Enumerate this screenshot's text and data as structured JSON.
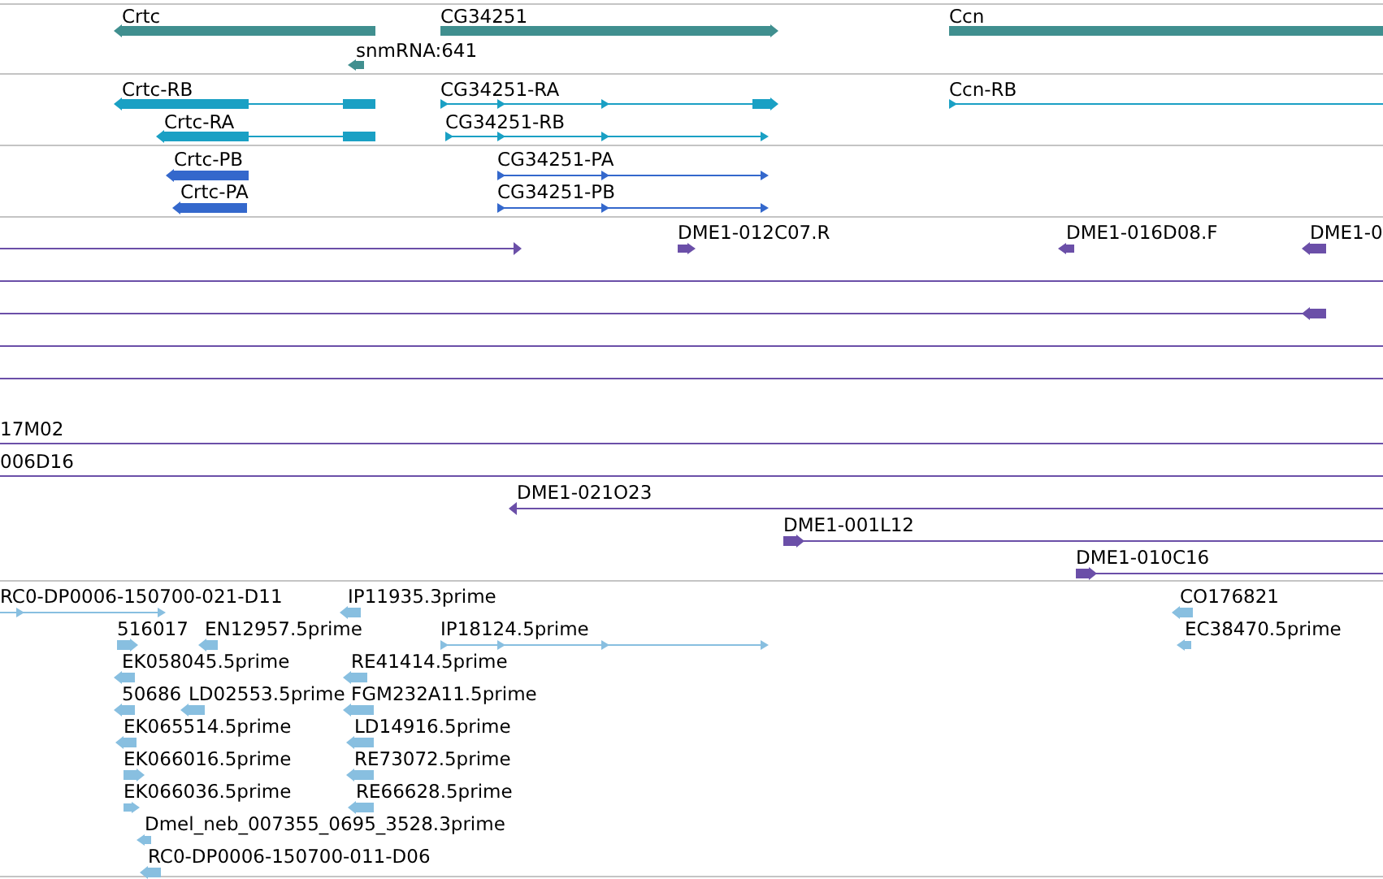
{
  "tracks": [
    {
      "kind": "gene",
      "features": [
        {
          "label": "Crtc",
          "reverse": true
        },
        {
          "label": "CG34251",
          "reverse": false
        },
        {
          "label": "snmRNA:641",
          "reverse": true
        },
        {
          "label": "Ccn",
          "clipped": true
        }
      ]
    },
    {
      "kind": "transcript",
      "features": [
        {
          "label": "Crtc-RB",
          "reverse": true
        },
        {
          "label": "Crtc-RA",
          "reverse": true
        },
        {
          "label": "CG34251-RA",
          "reverse": false
        },
        {
          "label": "CG34251-RB",
          "reverse": false
        },
        {
          "label": "Ccn-RB",
          "reverse": false,
          "clipped": true
        }
      ]
    },
    {
      "kind": "protein",
      "features": [
        {
          "label": "Crtc-PB",
          "reverse": true
        },
        {
          "label": "Crtc-PA",
          "reverse": true
        },
        {
          "label": "CG34251-PA",
          "reverse": false
        },
        {
          "label": "CG34251-PB",
          "reverse": false
        }
      ]
    },
    {
      "kind": "clone",
      "features": [
        {
          "reverse": false
        },
        {
          "label": "DME1-012C07.R",
          "reverse": false
        },
        {
          "label": "DME1-016D08.F",
          "reverse": true
        },
        {
          "label": "DME1-0",
          "reverse": true
        },
        {
          "clipped": true
        },
        {
          "reverse": true
        },
        {
          "clipped": true
        },
        {
          "clipped": true
        },
        {
          "label": "17M02",
          "clipped": true
        },
        {
          "label": "006D16",
          "clipped": true
        },
        {
          "label": "DME1-021O23",
          "reverse": true
        },
        {
          "label": "DME1-001L12",
          "reverse": false
        },
        {
          "label": "DME1-010C16",
          "reverse": false
        }
      ]
    },
    {
      "kind": "est",
      "features": [
        {
          "label": "RC0-DP0006-150700-021-D11",
          "reverse": false,
          "clipped": true
        },
        {
          "label": "IP11935.3prime",
          "reverse": true
        },
        {
          "label": "CO176821",
          "reverse": true
        },
        {
          "label": "516017",
          "reverse": false
        },
        {
          "label": "EN12957.5prime",
          "reverse": true
        },
        {
          "label": "IP18124.5prime",
          "reverse": false
        },
        {
          "label": "EC38470.5prime",
          "reverse": true
        },
        {
          "label": "EK058045.5prime",
          "reverse": true
        },
        {
          "label": "RE41414.5prime",
          "reverse": true
        },
        {
          "label": "50686",
          "reverse": true
        },
        {
          "label": "LD02553.5prime",
          "reverse": true
        },
        {
          "label": "FGM232A11.5prime",
          "reverse": true
        },
        {
          "label": "EK065514.5prime",
          "reverse": true
        },
        {
          "label": "LD14916.5prime",
          "reverse": true
        },
        {
          "label": "EK066016.5prime",
          "reverse": false
        },
        {
          "label": "RE73072.5prime",
          "reverse": true
        },
        {
          "label": "EK066036.5prime",
          "reverse": false
        },
        {
          "label": "RE66628.5prime",
          "reverse": true
        },
        {
          "label": "Dmel_neb_007355_0695_3528.3prime",
          "reverse": true
        },
        {
          "label": "RC0-DP0006-150700-011-D06",
          "reverse": true
        }
      ]
    }
  ]
}
